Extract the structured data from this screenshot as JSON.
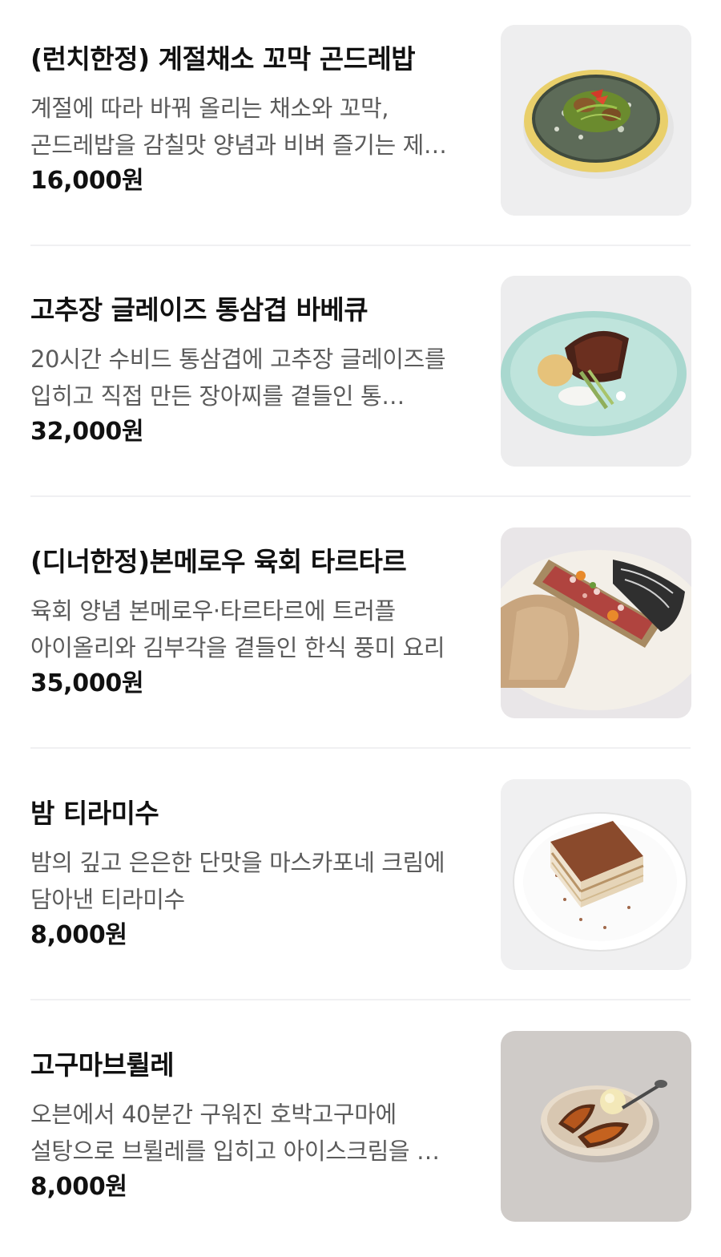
{
  "menu": {
    "items": [
      {
        "name": "(런치한정) 계절채소 꼬막 곤드레밥",
        "description": "계절에 따라 바꿔 올리는 채소와 꼬막, 곤드레밥을 감칠맛 양념과 비벼 즐기는 제…",
        "price": "16,000원",
        "image_icon": "gondre-rice-bowl-photo"
      },
      {
        "name": "고추장 글레이즈 통삼겹 바베큐",
        "description": "20시간 수비드 통삼겹에 고추장 글레이즈를 입히고 직접 만든 장아찌를 곁들인 통…",
        "price": "32,000원",
        "image_icon": "pork-belly-bbq-photo"
      },
      {
        "name": "(디너한정)본메로우 육회 타르타르",
        "description": "육회 양념 본메로우·타르타르에 트러플 아이올리와 김부각을 곁들인 한식 풍미 요리",
        "price": "35,000원",
        "image_icon": "bone-marrow-tartare-photo"
      },
      {
        "name": "밤 티라미수",
        "description": "밤의 깊고 은은한 단맛을 마스카포네 크림에 담아낸 티라미수",
        "price": "8,000원",
        "image_icon": "chestnut-tiramisu-photo"
      },
      {
        "name": "고구마브륄레",
        "description": "오븐에서 40분간 구워진 호박고구마에 설탕으로 브륄레를 입히고 아이스크림을 …",
        "price": "8,000원",
        "image_icon": "sweet-potato-brulee-photo"
      }
    ]
  },
  "colors": {
    "text_primary": "#111111",
    "text_secondary": "#5b5b5b",
    "divider": "#f0f0f2",
    "thumb_background": "#efeff0"
  }
}
